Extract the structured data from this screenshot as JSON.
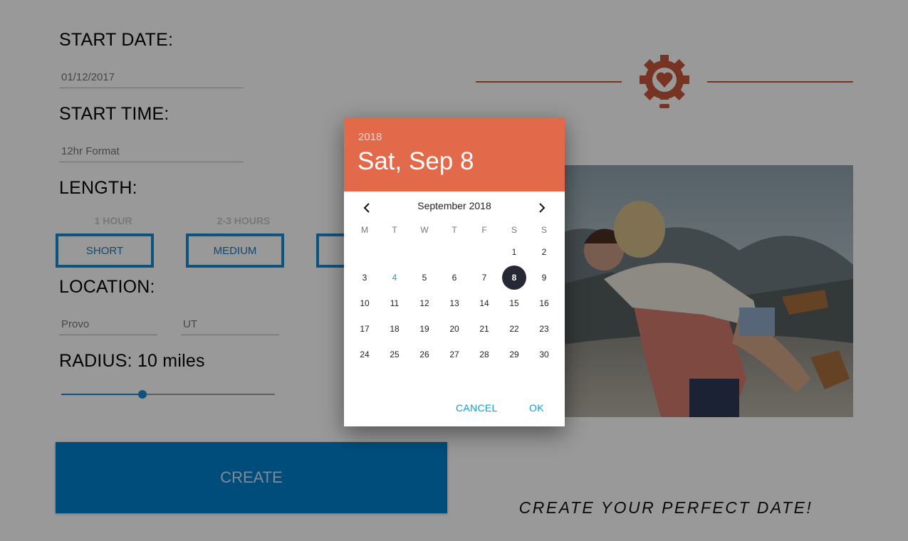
{
  "form": {
    "start_date_label": "START DATE:",
    "start_date_value": "01/12/2017",
    "start_time_label": "START TIME:",
    "start_time_placeholder": "12hr Format",
    "length_label": "LENGTH:",
    "length_hints": [
      "1 HOUR",
      "2-3 HOURS"
    ],
    "length_options": [
      "SHORT",
      "MEDIUM"
    ],
    "location_label": "LOCATION:",
    "city_value": "Provo",
    "state_value": "UT",
    "radius_label": "RADIUS: 10 miles",
    "radius_fraction": 0.38,
    "create_label": "CREATE"
  },
  "right": {
    "logo_icon": "gear-heart-lightbulb-icon",
    "photo": "couple-embracing-mountain-photo",
    "tagline": "CREATE YOUR PERFECT DATE!",
    "accent_color": "#c7573b"
  },
  "date_picker": {
    "year": "2018",
    "selected_label": "Sat, Sep 8",
    "month_title": "September 2018",
    "weekdays": [
      "M",
      "T",
      "W",
      "T",
      "F",
      "S",
      "S"
    ],
    "first_weekday_index": 5,
    "days_in_month": 30,
    "today": 4,
    "selected_day": 8,
    "cancel_label": "CANCEL",
    "ok_label": "OK",
    "header_color": "#e2694a",
    "accent_color": "#0a9de0"
  }
}
